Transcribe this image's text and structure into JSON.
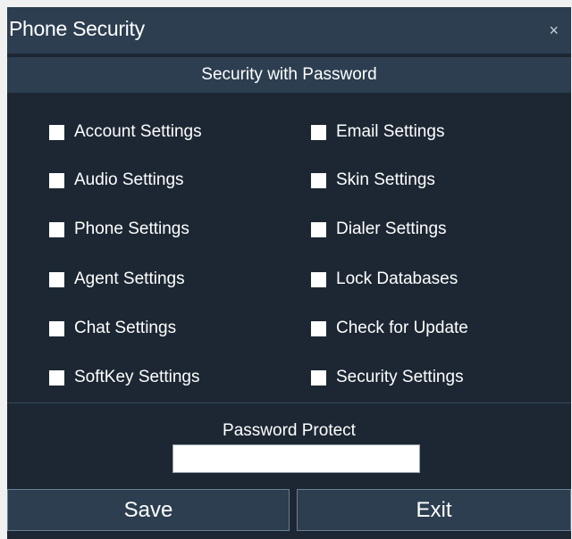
{
  "window": {
    "title": "Phone Security",
    "close_glyph": "×"
  },
  "section": {
    "header": "Security with Password"
  },
  "options": [
    {
      "label": "Account Settings"
    },
    {
      "label": "Email Settings"
    },
    {
      "label": "Audio Settings"
    },
    {
      "label": "Skin Settings"
    },
    {
      "label": "Phone Settings"
    },
    {
      "label": "Dialer Settings"
    },
    {
      "label": "Agent Settings"
    },
    {
      "label": "Lock Databases"
    },
    {
      "label": "Chat Settings"
    },
    {
      "label": "Check for Update"
    },
    {
      "label": "SoftKey Settings"
    },
    {
      "label": "Security Settings"
    }
  ],
  "password": {
    "label": "Password Protect",
    "value": "",
    "placeholder": ""
  },
  "buttons": {
    "save": "Save",
    "exit": "Exit"
  },
  "colors": {
    "background": "#1c2733",
    "bar": "#2c3e50",
    "text": "#ffffff"
  }
}
